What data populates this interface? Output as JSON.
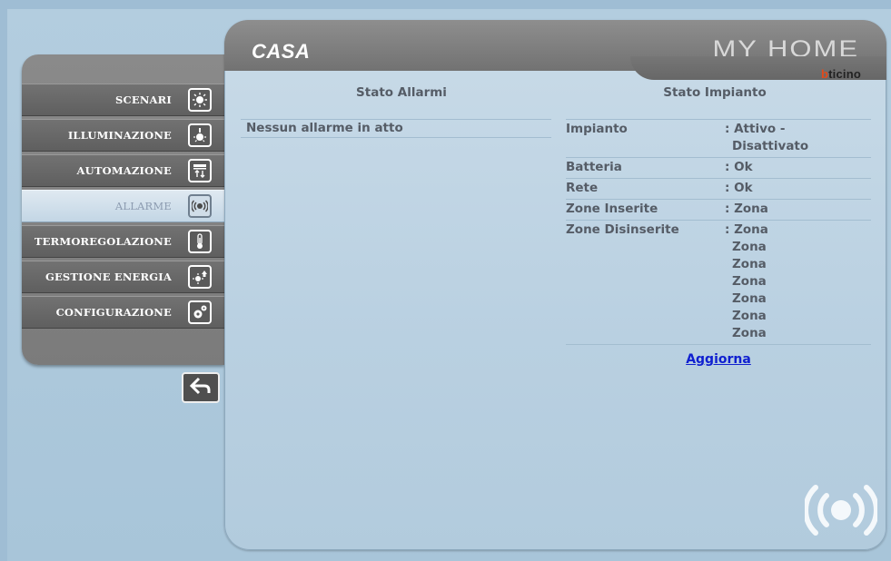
{
  "header": {
    "title": "CASA",
    "brand": "MY HOME",
    "brand_sub_b": "b",
    "brand_sub_rest": "ticino"
  },
  "sidebar": {
    "items": [
      {
        "label": "SCENARI",
        "icon": "scenari-icon",
        "active": false
      },
      {
        "label": "ILLUMINAZIONE",
        "icon": "lightbulb-icon",
        "active": false
      },
      {
        "label": "AUTOMAZIONE",
        "icon": "shutter-icon",
        "active": false
      },
      {
        "label": "ALLARME",
        "icon": "alarm-icon",
        "active": true
      },
      {
        "label": "TERMOREGOLAZIONE",
        "icon": "thermometer-icon",
        "active": false
      },
      {
        "label": "GESTIONE ENERGIA",
        "icon": "energy-icon",
        "active": false
      },
      {
        "label": "CONFIGURAZIONE",
        "icon": "gears-icon",
        "active": false
      }
    ],
    "back_icon": "back-arrow-icon"
  },
  "alarms": {
    "heading": "Stato Allarmi",
    "message": "Nessun allarme in atto"
  },
  "plant": {
    "heading": "Stato Impianto",
    "impianto_label": "Impianto",
    "impianto_value_1": ": Attivo -",
    "impianto_value_2": "Disattivato",
    "batteria_label": "Batteria",
    "batteria_value": ": Ok",
    "rete_label": "Rete",
    "rete_value": ": Ok",
    "inserite_label": "Zone Inserite",
    "inserite_value": ": Zona",
    "disinserite_label": "Zone Disinserite",
    "disinserite_values": [
      ": Zona",
      "Zona",
      "Zona",
      "Zona",
      "Zona",
      "Zona",
      "Zona"
    ],
    "refresh_label": "Aggiorna"
  },
  "colors": {
    "accent_link": "#1020d0",
    "brand_b": "#e24a1a"
  }
}
